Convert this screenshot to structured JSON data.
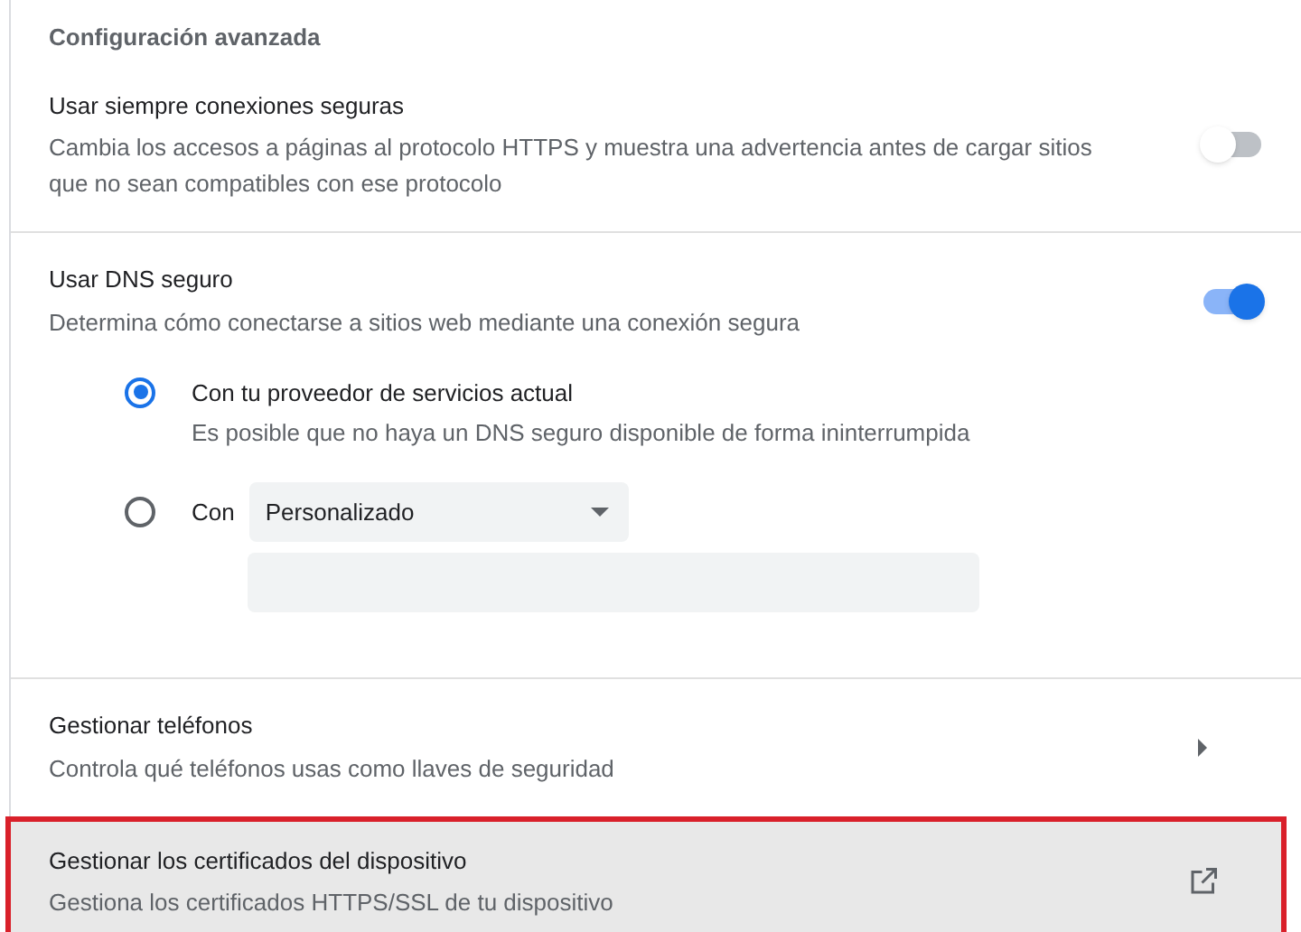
{
  "section_title": "Configuración avanzada",
  "settings": [
    {
      "kind": "toggle",
      "title": "Usar siempre conexiones seguras",
      "description": "Cambia los accesos a páginas al protocolo HTTPS y muestra una advertencia antes de cargar sitios que no sean compatibles con ese protocolo",
      "on": false
    },
    {
      "kind": "toggle",
      "title": "Usar DNS seguro",
      "description": "Determina cómo conectarse a sitios web mediante una conexión segura",
      "on": true,
      "options": [
        {
          "kind": "plain",
          "label": "Con tu proveedor de servicios actual",
          "description": "Es posible que no haya un DNS seguro disponible de forma ininterrumpida",
          "selected": true
        },
        {
          "kind": "custom",
          "label": "Con",
          "dropdown_value": "Personalizado",
          "selected": false
        }
      ]
    },
    {
      "kind": "submenu",
      "title": "Gestionar teléfonos",
      "description": "Controla qué teléfonos usas como llaves de seguridad"
    },
    {
      "kind": "external",
      "title": "Gestionar los certificados del dispositivo",
      "description": "Gestiona los certificados HTTPS/SSL de tu dispositivo",
      "highlighted": true
    }
  ]
}
